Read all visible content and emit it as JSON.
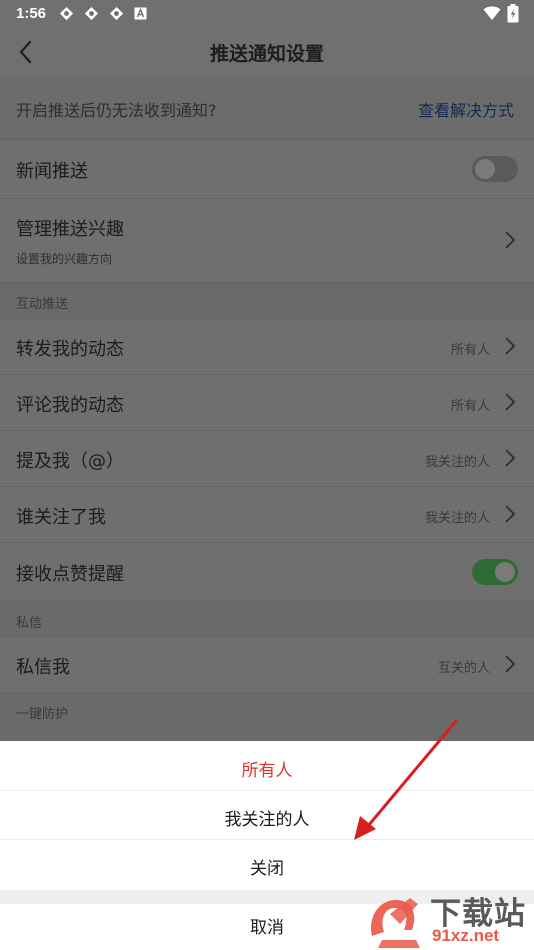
{
  "status_bar": {
    "time": "1:56"
  },
  "header": {
    "title": "推送通知设置"
  },
  "tip": {
    "text": "开启推送后仍无法收到通知?",
    "link": "查看解决方式"
  },
  "rows": {
    "news": {
      "label": "新闻推送",
      "enabled": false
    },
    "interest": {
      "label": "管理推送兴趣",
      "sub": "设置我的兴趣方向"
    },
    "interaction_header": "互动推送",
    "repost": {
      "label": "转发我的动态",
      "value": "所有人"
    },
    "comment": {
      "label": "评论我的动态",
      "value": "所有人"
    },
    "mention": {
      "label": "提及我（@）",
      "value": "我关注的人"
    },
    "follow": {
      "label": "谁关注了我",
      "value": "我关注的人"
    },
    "likes": {
      "label": "接收点赞提醒",
      "enabled": true
    },
    "dm_header": "私信",
    "dm": {
      "label": "私信我",
      "value": "互关的人"
    },
    "protect_header": "一键防护"
  },
  "sheet": {
    "options": [
      "所有人",
      "我关注的人",
      "关闭"
    ],
    "selected_index": 0,
    "cancel": "取消"
  },
  "colors": {
    "accent_red": "#e3322c",
    "toggle_on": "#2f7d3a"
  },
  "watermark": {
    "mark": "9f",
    "text": "下载站",
    "url": "91xz.net"
  }
}
